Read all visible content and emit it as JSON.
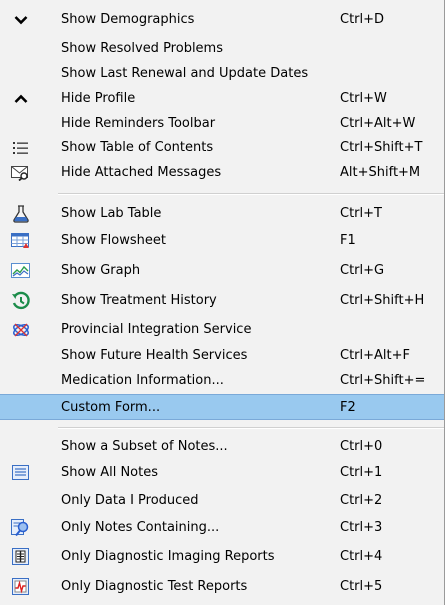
{
  "menu": {
    "items": [
      {
        "label": "Show Demographics",
        "shortcut": "Ctrl+D",
        "icon": "chevron-down-icon"
      },
      {
        "label": "Show Resolved Problems",
        "shortcut": "",
        "icon": ""
      },
      {
        "label": "Show Last Renewal and Update Dates",
        "shortcut": "",
        "icon": ""
      },
      {
        "label": "Hide Profile",
        "shortcut": "Ctrl+W",
        "icon": "chevron-up-icon"
      },
      {
        "label": "Hide Reminders Toolbar",
        "shortcut": "Ctrl+Alt+W",
        "icon": ""
      },
      {
        "label": "Show Table of Contents",
        "shortcut": "Ctrl+Shift+T",
        "icon": "list-icon"
      },
      {
        "label": "Hide Attached Messages",
        "shortcut": "Alt+Shift+M",
        "icon": "envelope-search-icon"
      },
      {
        "label": "Show Lab Table",
        "shortcut": "Ctrl+T",
        "icon": "flask-icon"
      },
      {
        "label": "Show Flowsheet",
        "shortcut": "F1",
        "icon": "flowsheet-icon"
      },
      {
        "label": "Show Graph",
        "shortcut": "Ctrl+G",
        "icon": "graph-icon"
      },
      {
        "label": "Show Treatment History",
        "shortcut": "Ctrl+Shift+H",
        "icon": "history-icon"
      },
      {
        "label": "Provincial Integration Service",
        "shortcut": "",
        "icon": "integration-icon"
      },
      {
        "label": "Show Future Health Services",
        "shortcut": "Ctrl+Alt+F",
        "icon": ""
      },
      {
        "label": "Medication Information...",
        "shortcut": "Ctrl+Shift+=",
        "icon": ""
      },
      {
        "label": "Custom Form...",
        "shortcut": "F2",
        "icon": "",
        "highlighted": true
      },
      {
        "label": "Show a Subset of Notes...",
        "shortcut": "Ctrl+0",
        "icon": ""
      },
      {
        "label": "Show All Notes",
        "shortcut": "Ctrl+1",
        "icon": "notes-icon"
      },
      {
        "label": "Only Data I Produced",
        "shortcut": "Ctrl+2",
        "icon": ""
      },
      {
        "label": "Only Notes Containing...",
        "shortcut": "Ctrl+3",
        "icon": "search-notes-icon"
      },
      {
        "label": "Only Diagnostic Imaging Reports",
        "shortcut": "Ctrl+4",
        "icon": "imaging-report-icon"
      },
      {
        "label": "Only Diagnostic Test Reports",
        "shortcut": "Ctrl+5",
        "icon": "test-report-icon"
      }
    ]
  },
  "colors": {
    "menu_background": "#f2f2f2",
    "highlight": "#99c9ef",
    "separator": "#d0d0d0"
  }
}
